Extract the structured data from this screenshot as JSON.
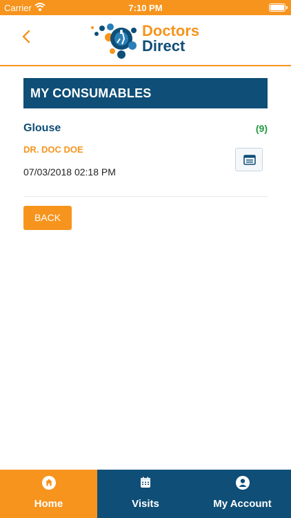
{
  "status_bar": {
    "carrier": "Carrier",
    "time": "7:10 PM"
  },
  "header": {
    "logo_line1": "Doctors",
    "logo_line2": "Direct"
  },
  "section": {
    "title": "MY CONSUMABLES"
  },
  "item": {
    "name": "Glouse",
    "count": "(9)",
    "doctor": "DR. DOC DOE",
    "datetime": "07/03/2018 02:18 PM"
  },
  "actions": {
    "back_label": "BACK"
  },
  "tabs": [
    {
      "label": "Home",
      "icon": "home-icon",
      "active": true
    },
    {
      "label": "Visits",
      "icon": "calendar-icon",
      "active": false
    },
    {
      "label": "My Account",
      "icon": "user-icon",
      "active": false
    }
  ],
  "colors": {
    "accent": "#f7941d",
    "primary": "#0e4e77",
    "count_green": "#1f9a3d"
  }
}
